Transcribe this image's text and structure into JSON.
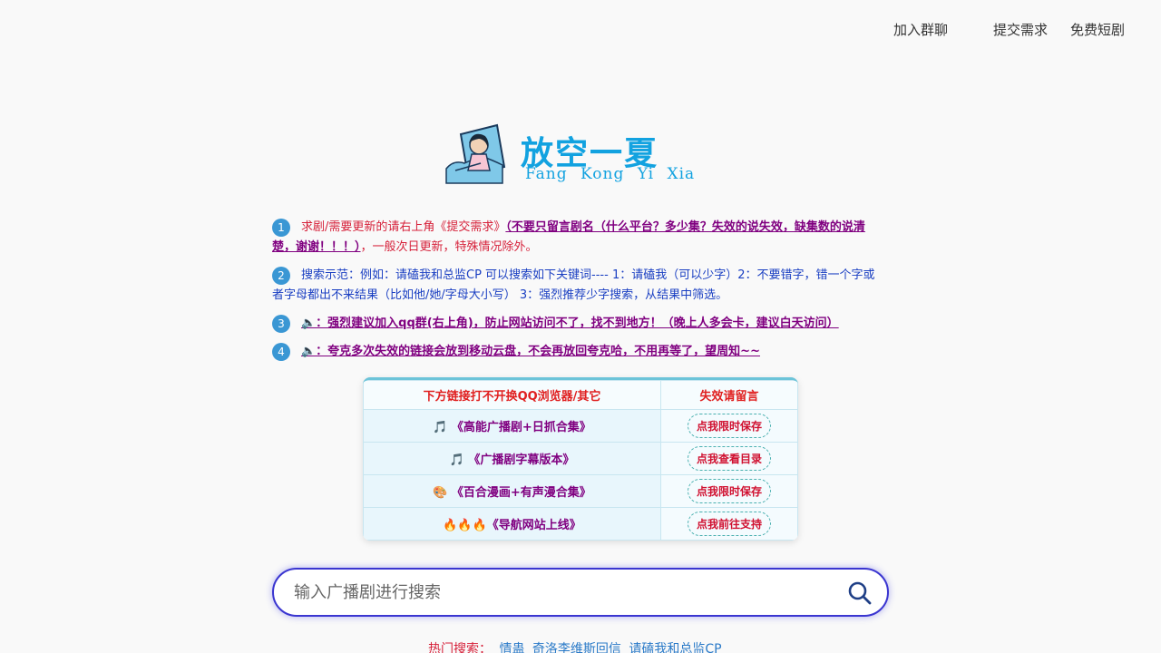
{
  "nav": {
    "join_group": "加入群聊",
    "submit_request": "提交需求",
    "free_shorts": "免费短剧"
  },
  "logo": {
    "title": "放空一夏",
    "subtitle": "Fang Kong Yi Xia"
  },
  "notices": [
    {
      "num": "1",
      "text": "求剧/需要更新的请右上角《提交需求》",
      "link": "（不要只留言剧名（什么平台？多少集？失效的说失效，缺集数的说清楚，谢谢！！！）",
      "tail": "，一般次日更新，特殊情况除外。"
    },
    {
      "num": "2",
      "text": "搜索示范：例如：请磕我和总监CP 可以搜索如下关键词---- 1：请磕我（可以少字）2：不要错字，错一个字或者字母都出不来结果（比如他/她/字母大小写） 3：强烈推荐少字搜索，从结果中筛选。"
    },
    {
      "num": "3",
      "link": "🔈：强烈建议加入qq群(右上角)，防止网站访问不了，找不到地方！（晚上人多会卡，建议白天访问）"
    },
    {
      "num": "4",
      "link": "🔈：夸克多次失效的链接会放到移动云盘，不会再放回夸克哈，不用再等了，望周知~~"
    }
  ],
  "table": {
    "header_left": "下方链接打不开换QQ浏览器/其它",
    "header_right": "失效请留言",
    "rows": [
      {
        "title": "🎵 《高能广播剧+日抓合集》",
        "action": "点我限时保存"
      },
      {
        "title": "🎵 《广播剧字幕版本》",
        "action": "点我查看目录"
      },
      {
        "title": "🎨 《百合漫画+有声漫合集》",
        "action": "点我限时保存"
      },
      {
        "title": "🔥🔥🔥《导航网站上线》",
        "action": "点我前往支持"
      }
    ]
  },
  "search": {
    "placeholder": "输入广播剧进行搜索"
  },
  "hot": {
    "label": "热门搜索：",
    "items": [
      "情蛊",
      "奇洛李维斯回信",
      "请磕我和总监CP"
    ]
  },
  "colors": {
    "accent": "#12a2e0",
    "badge": "#3a97d4",
    "link_purple": "#800080",
    "notice_red": "#d6213a",
    "notice_blue": "#1a3fc2",
    "search_border": "#3a35d0"
  }
}
